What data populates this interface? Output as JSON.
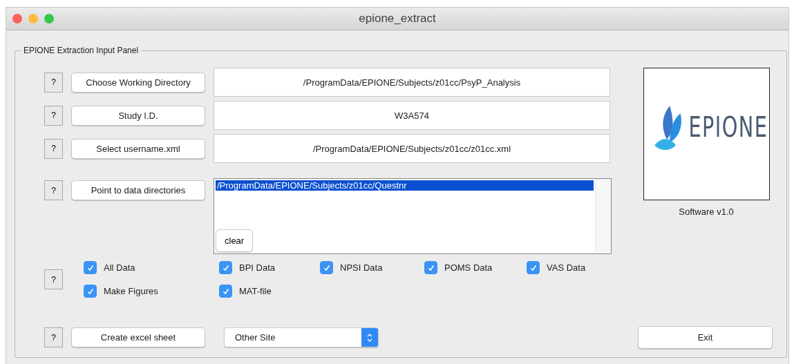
{
  "window": {
    "title": "epione_extract"
  },
  "panel": {
    "title": "EPIONE Extraction Input Panel"
  },
  "rows": [
    {
      "help": "?",
      "button": "Choose Working Directory",
      "value": "/ProgramData/EPIONE/Subjects/z01cc/PsyP_Analysis"
    },
    {
      "help": "?",
      "button": "Study I.D.",
      "value": "W3A574"
    },
    {
      "help": "?",
      "button": "Select username.xml",
      "value": "/ProgramData/EPIONE/Subjects/z01cc/z01cc.xml"
    }
  ],
  "directories": {
    "help": "?",
    "button": "Point to data directories",
    "items": [
      {
        "text": "/ProgramData/EPIONE/Subjects/z01cc/Questnr",
        "selected": true
      }
    ],
    "clear_button": "clear"
  },
  "options": {
    "help": "?",
    "checkboxes": [
      {
        "label": "All Data",
        "checked": true
      },
      {
        "label": "BPI Data",
        "checked": true
      },
      {
        "label": "NPSI Data",
        "checked": true
      },
      {
        "label": "POMS Data",
        "checked": true
      },
      {
        "label": "VAS Data",
        "checked": true
      },
      {
        "label": "Make Figures",
        "checked": true
      },
      {
        "label": "MAT-file",
        "checked": true
      }
    ]
  },
  "export": {
    "help": "?",
    "button": "Create excel sheet",
    "site": {
      "value": "Other Site"
    }
  },
  "exit_button": "Exit",
  "logo": {
    "text": "EPIONE",
    "caption": "Software v1.0"
  }
}
